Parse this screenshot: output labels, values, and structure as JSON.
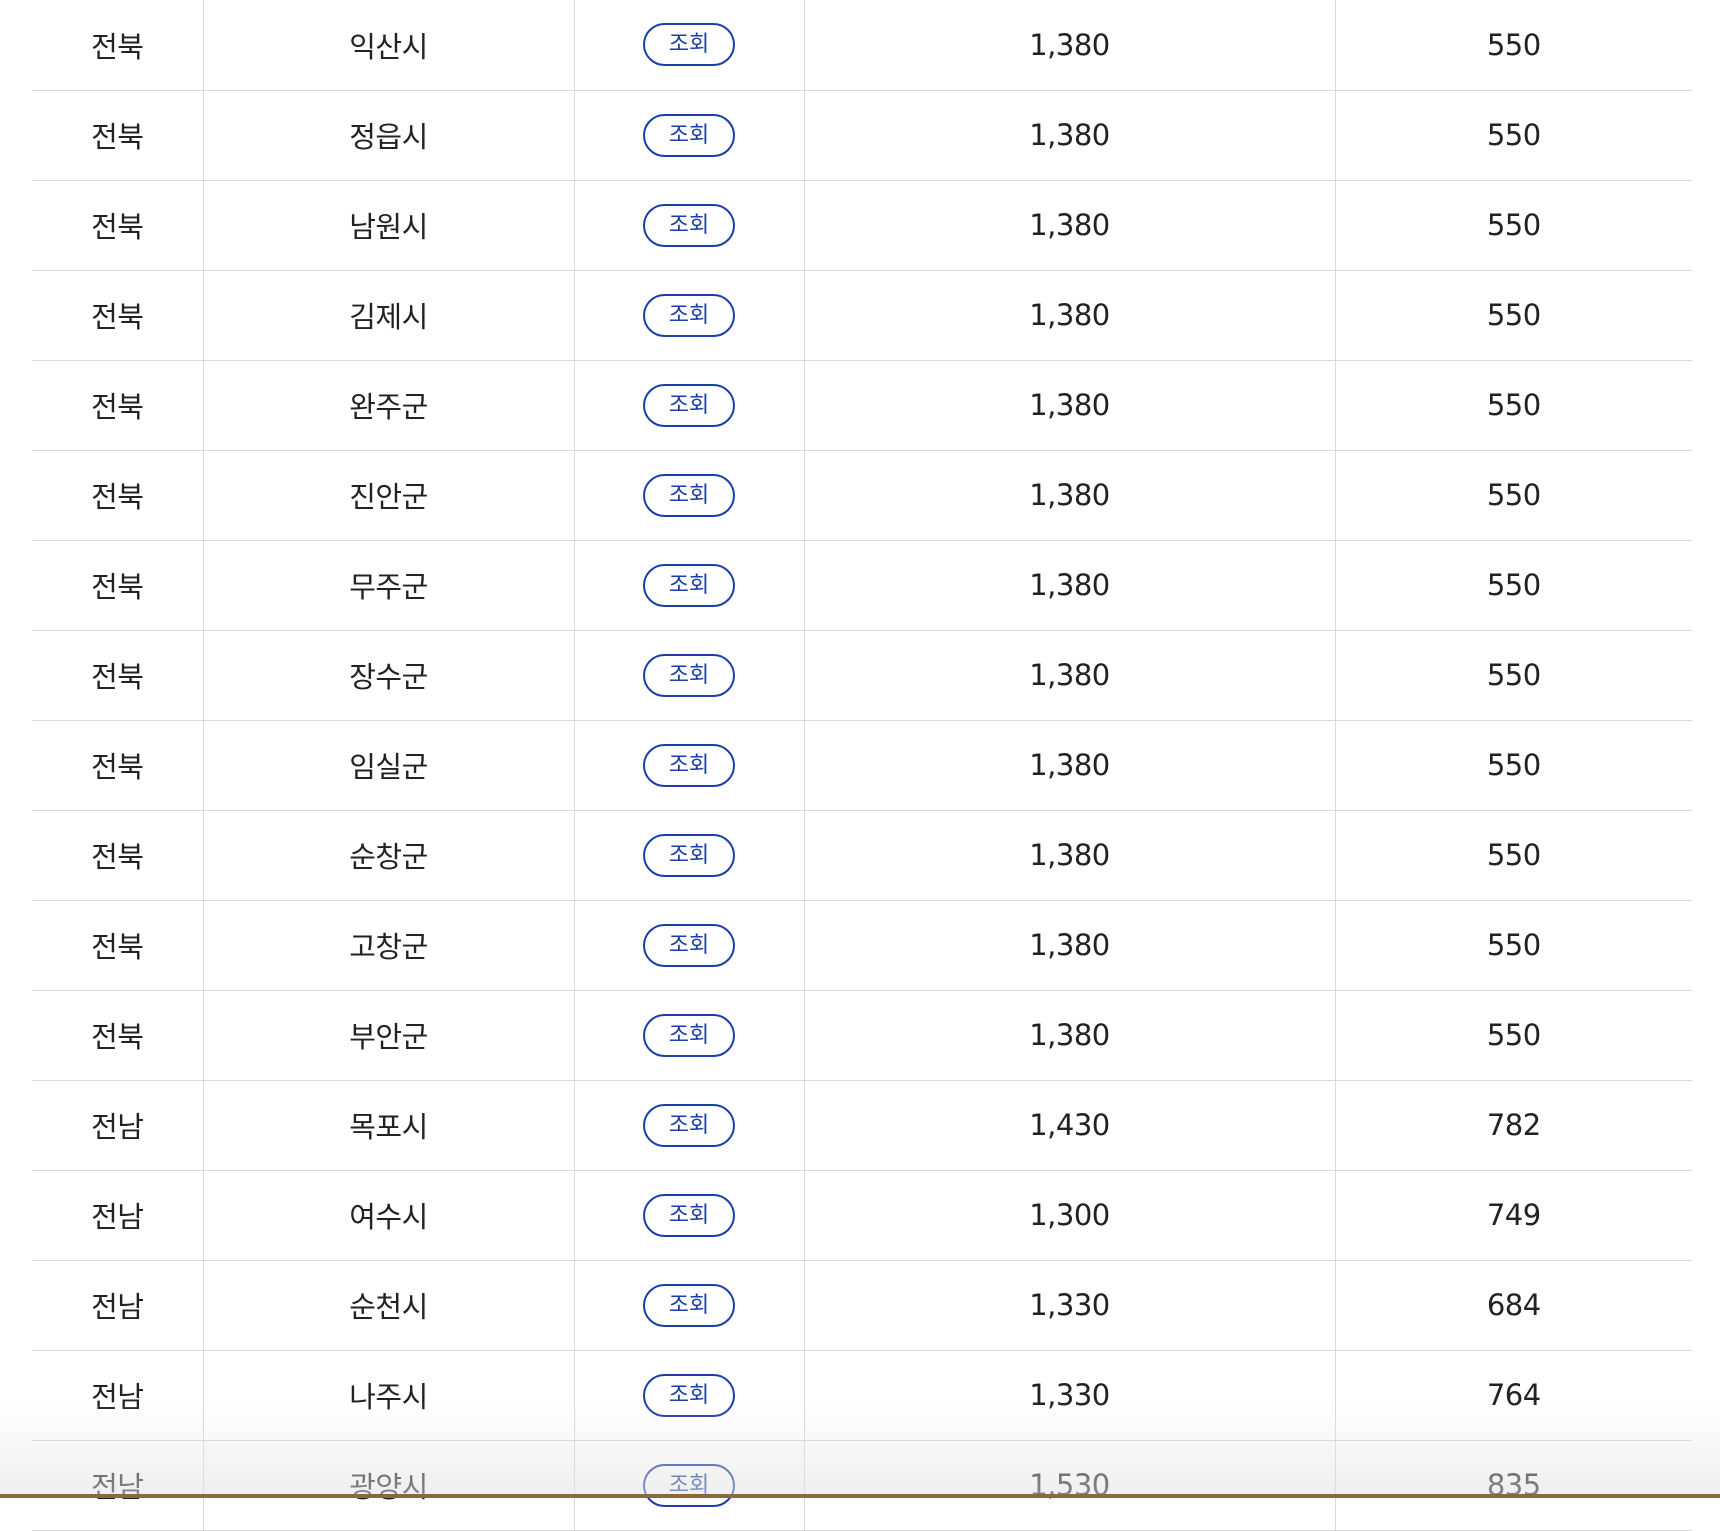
{
  "table": {
    "rows": [
      {
        "region": "전북",
        "city": "익산시",
        "view": "조회",
        "fee1": "1,380",
        "fee2": "550"
      },
      {
        "region": "전북",
        "city": "정읍시",
        "view": "조회",
        "fee1": "1,380",
        "fee2": "550"
      },
      {
        "region": "전북",
        "city": "남원시",
        "view": "조회",
        "fee1": "1,380",
        "fee2": "550"
      },
      {
        "region": "전북",
        "city": "김제시",
        "view": "조회",
        "fee1": "1,380",
        "fee2": "550"
      },
      {
        "region": "전북",
        "city": "완주군",
        "view": "조회",
        "fee1": "1,380",
        "fee2": "550"
      },
      {
        "region": "전북",
        "city": "진안군",
        "view": "조회",
        "fee1": "1,380",
        "fee2": "550"
      },
      {
        "region": "전북",
        "city": "무주군",
        "view": "조회",
        "fee1": "1,380",
        "fee2": "550"
      },
      {
        "region": "전북",
        "city": "장수군",
        "view": "조회",
        "fee1": "1,380",
        "fee2": "550"
      },
      {
        "region": "전북",
        "city": "임실군",
        "view": "조회",
        "fee1": "1,380",
        "fee2": "550"
      },
      {
        "region": "전북",
        "city": "순창군",
        "view": "조회",
        "fee1": "1,380",
        "fee2": "550"
      },
      {
        "region": "전북",
        "city": "고창군",
        "view": "조회",
        "fee1": "1,380",
        "fee2": "550"
      },
      {
        "region": "전북",
        "city": "부안군",
        "view": "조회",
        "fee1": "1,380",
        "fee2": "550"
      },
      {
        "region": "전남",
        "city": "목포시",
        "view": "조회",
        "fee1": "1,430",
        "fee2": "782"
      },
      {
        "region": "전남",
        "city": "여수시",
        "view": "조회",
        "fee1": "1,300",
        "fee2": "749"
      },
      {
        "region": "전남",
        "city": "순천시",
        "view": "조회",
        "fee1": "1,330",
        "fee2": "684"
      },
      {
        "region": "전남",
        "city": "나주시",
        "view": "조회",
        "fee1": "1,330",
        "fee2": "764"
      },
      {
        "region": "전남",
        "city": "광양시",
        "view": "조회",
        "fee1": "1,530",
        "fee2": "835"
      }
    ]
  },
  "colors": {
    "button_accent": "#1b3ea8",
    "row_border": "#d9d9d9",
    "text": "#222222"
  }
}
